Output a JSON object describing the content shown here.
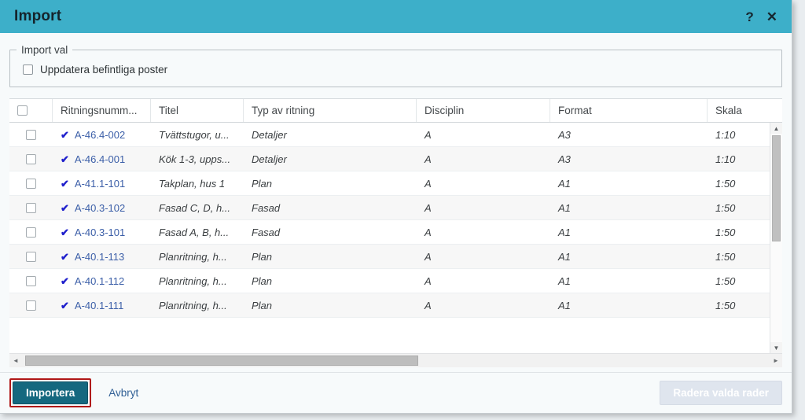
{
  "dialog": {
    "title": "Import",
    "help_icon": "question-mark-icon",
    "help_glyph": "?",
    "close_icon": "close-icon",
    "close_glyph": "✕",
    "header_color": "#3dafc9"
  },
  "options": {
    "legend": "Import val",
    "checkbox_label": "Uppdatera befintliga poster",
    "checkbox_checked": false
  },
  "grid": {
    "select_all_checked": false,
    "columns": [
      {
        "key": "select",
        "label": ""
      },
      {
        "key": "nr",
        "label": "Ritningsnumm..."
      },
      {
        "key": "titel",
        "label": "Titel"
      },
      {
        "key": "typ",
        "label": "Typ av ritning"
      },
      {
        "key": "disciplin",
        "label": "Disciplin"
      },
      {
        "key": "format",
        "label": "Format"
      },
      {
        "key": "skala",
        "label": "Skala"
      }
    ],
    "rows": [
      {
        "checked": false,
        "mark": "✔",
        "nr": "A-46.4-002",
        "titel": "Tvättstugor, u...",
        "typ": "Detaljer",
        "disciplin": "A",
        "format": "A3",
        "skala": "1:10"
      },
      {
        "checked": false,
        "mark": "✔",
        "nr": "A-46.4-001",
        "titel": "Kök 1-3, upps...",
        "typ": "Detaljer",
        "disciplin": "A",
        "format": "A3",
        "skala": "1:10"
      },
      {
        "checked": false,
        "mark": "✔",
        "nr": "A-41.1-101",
        "titel": "Takplan, hus 1",
        "typ": "Plan",
        "disciplin": "A",
        "format": "A1",
        "skala": "1:50"
      },
      {
        "checked": false,
        "mark": "✔",
        "nr": "A-40.3-102",
        "titel": "Fasad C, D, h...",
        "typ": "Fasad",
        "disciplin": "A",
        "format": "A1",
        "skala": "1:50"
      },
      {
        "checked": false,
        "mark": "✔",
        "nr": "A-40.3-101",
        "titel": "Fasad A, B, h...",
        "typ": "Fasad",
        "disciplin": "A",
        "format": "A1",
        "skala": "1:50"
      },
      {
        "checked": false,
        "mark": "✔",
        "nr": "A-40.1-113",
        "titel": "Planritning, h...",
        "typ": "Plan",
        "disciplin": "A",
        "format": "A1",
        "skala": "1:50"
      },
      {
        "checked": false,
        "mark": "✔",
        "nr": "A-40.1-112",
        "titel": "Planritning, h...",
        "typ": "Plan",
        "disciplin": "A",
        "format": "A1",
        "skala": "1:50"
      },
      {
        "checked": false,
        "mark": "✔",
        "nr": "A-40.1-111",
        "titel": "Planritning, h...",
        "typ": "Plan",
        "disciplin": "A",
        "format": "A1",
        "skala": "1:50"
      }
    ]
  },
  "scrollbars": {
    "vertical_up_glyph": "▲",
    "vertical_down_glyph": "▼",
    "horizontal_left_glyph": "◄",
    "horizontal_right_glyph": "►"
  },
  "footer": {
    "import_label": "Importera",
    "cancel_label": "Avbryt",
    "delete_label": "Radera valda rader",
    "delete_disabled": true,
    "import_highlight_color": "#b01717",
    "import_button_color": "#15687f"
  }
}
